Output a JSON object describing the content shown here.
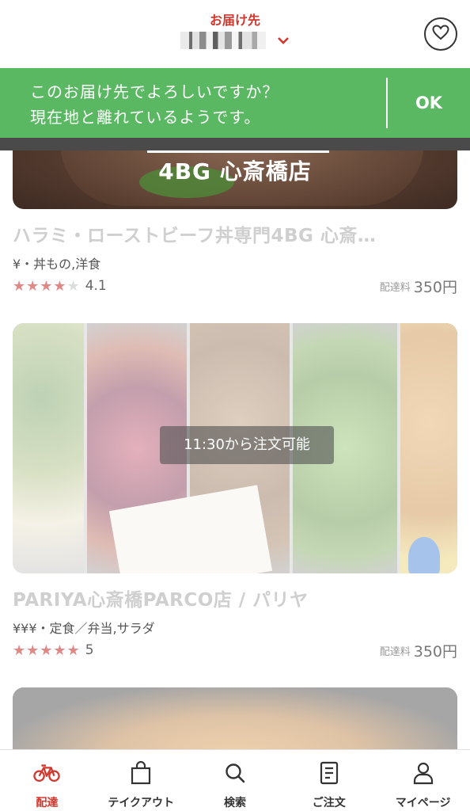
{
  "header": {
    "deliver_label": "お届け先",
    "favorite_icon": "heart-icon"
  },
  "banner": {
    "line1": "このお届け先でよろしいですか？",
    "line2": "現在地と離れているようです。",
    "ok_label": "OK",
    "background": "#5ab863"
  },
  "restaurants": [
    {
      "image_text": "4BG 心斎橋店",
      "name": "ハラミ・ローストビーフ丼専門4BG 心斎…",
      "category": "¥・丼もの,洋食",
      "rating": "4.1",
      "stars_filled": 4,
      "fee_label": "配達料",
      "fee": "350円"
    },
    {
      "badge": "11:30から注文可能",
      "name": "PARIYA心斎橋PARCO店 / パリヤ",
      "category": "¥¥¥・定食／弁当,サラダ",
      "rating": "5",
      "stars_filled": 5,
      "fee_label": "配達料",
      "fee": "350円"
    }
  ],
  "nav": {
    "items": [
      {
        "label": "配達",
        "icon": "bicycle-icon",
        "active": true
      },
      {
        "label": "テイクアウト",
        "icon": "shopping-bag-icon",
        "active": false
      },
      {
        "label": "検索",
        "icon": "search-icon",
        "active": false
      },
      {
        "label": "ご注文",
        "icon": "receipt-icon",
        "active": false
      },
      {
        "label": "マイページ",
        "icon": "user-icon",
        "active": false
      }
    ]
  },
  "colors": {
    "accent": "#d2372d",
    "star": "#e08886"
  }
}
